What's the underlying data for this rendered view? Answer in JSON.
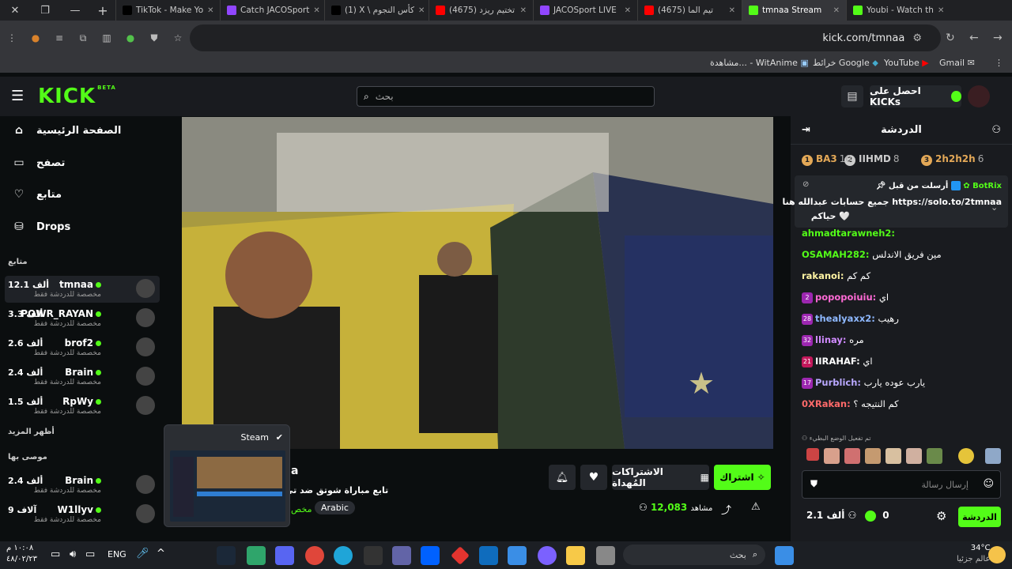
{
  "browser": {
    "tabs": [
      {
        "label": "TikTok - Make Yo",
        "icon": "tiktok-icon",
        "color": "#000000"
      },
      {
        "label": "Catch JACOSport",
        "icon": "twitch-icon",
        "color": "#9146ff"
      },
      {
        "label": "(1) X \\ كأس النجوم",
        "icon": "x-icon",
        "color": "#000000"
      },
      {
        "label": "(4675) تختيم ريزد",
        "icon": "youtube-icon",
        "color": "#ff0000"
      },
      {
        "label": "JACOSport LIVE",
        "icon": "twitch-icon",
        "color": "#9146ff"
      },
      {
        "label": "(4675) تيم الما",
        "icon": "youtube-icon",
        "color": "#ff0000"
      },
      {
        "label": "tmnaa Stream",
        "icon": "kick-icon",
        "color": "#53fc18",
        "active": true
      },
      {
        "label": "Youbi - Watch th",
        "icon": "kick-icon",
        "color": "#53fc18"
      }
    ],
    "url": "kick.com/tmnaa",
    "bookmarks": [
      "Gmail",
      "YouTube",
      "خرائط Google",
      "مشاهدة... - WitAnime"
    ]
  },
  "kick": {
    "logo": "KICK",
    "logo_badge": "BETA",
    "search_placeholder": "بحث",
    "get_kicks": "احصل على KICKs",
    "nav": [
      {
        "label": "الصفحة الرئيسية",
        "icon": "home-icon"
      },
      {
        "label": "تصفح",
        "icon": "browse-icon"
      },
      {
        "label": "متابع",
        "icon": "heart-icon"
      },
      {
        "label": "Drops",
        "icon": "drops-icon"
      }
    ],
    "following_title": "متابع",
    "show_more": "أظهر المزيد",
    "recommended_title": "موصى بها",
    "following": [
      {
        "name": "tmnaa",
        "count": "12.1 ألف",
        "sub": "مخصصة للدردشة فقط",
        "active": true
      },
      {
        "name": "POWR_RAYAN",
        "count": "3.3 ألف",
        "sub": "مخصصة للدردشة فقط"
      },
      {
        "name": "brof2",
        "count": "2.6 ألف",
        "sub": "مخصصة للدردشة فقط"
      },
      {
        "name": "Brain",
        "count": "2.4 ألف",
        "sub": "مخصصة للدردشة فقط"
      },
      {
        "name": "RpWy",
        "count": "1.5 ألف",
        "sub": "مخصصة للدردشة فقط"
      }
    ],
    "recommended": [
      {
        "name": "Brain",
        "count": "2.4 ألف",
        "sub": "مخصصة للدردشة فقط"
      },
      {
        "name": "W1llyv",
        "count": "9 آلاف",
        "sub": "مخصصة للدردشة فقط"
      }
    ],
    "stream": {
      "title_partial": "a",
      "subtitle": "تابع مباراة شوتق ضد تي",
      "tag_language": "Arabic",
      "tag_partial": "مخص",
      "viewers": "12,083",
      "viewers_label": "مشاهد",
      "subscribe": "اشتراك",
      "gift_subs": "الاشتراكات المُهداة"
    },
    "chat": {
      "title": "الدردشة",
      "leaderboard": [
        {
          "name": "2h2h2h",
          "num": "6",
          "rank": "3",
          "color": "#e3a857"
        },
        {
          "name": "IIHMD",
          "num": "8",
          "rank": "2",
          "color": "#cccccc"
        },
        {
          "name": "BA3",
          "num": "10",
          "rank": "1",
          "color": "#e3a857"
        }
      ],
      "pinned_user": "BotRix",
      "pinned_by": "أرسلت من قبل",
      "pinned_text": "جميع حسابات عبدالله هنا https://solo.to/2tmnaa",
      "pinned_text2": "حياكم 🤍",
      "messages": [
        {
          "user": "ahmadtarawneh2:",
          "text": "",
          "color": "#53fc18",
          "badge": ""
        },
        {
          "user": "OSAMAH282:",
          "text": "مين فريق الاندلس",
          "color": "#53fc18",
          "badge": ""
        },
        {
          "user": "rakanoi:",
          "text": "كم كم",
          "color": "#fff4a3",
          "badge": ""
        },
        {
          "user": "popopoiuiu:",
          "text": "اي",
          "color": "#ff6ad5",
          "badge": "2"
        },
        {
          "user": "thealyaxx2:",
          "text": "رهيب",
          "color": "#8eb8ff",
          "badge": "28"
        },
        {
          "user": "llinay:",
          "text": "مره",
          "color": "#d08bff",
          "badge": "32"
        },
        {
          "user": "IIRAHAF:",
          "text": "اي",
          "color": "#ffffff",
          "badge": "21"
        },
        {
          "user": "Purblich:",
          "text": "يارب عوده يارب",
          "color": "#b9a8ff",
          "badge": "17"
        },
        {
          "user": "0XRakan:",
          "text": "كم النتيجه ؟",
          "color": "#ff6a6a",
          "badge": ""
        }
      ],
      "slow_mode": "تم تفعيل الوضع البطيء",
      "input_placeholder": "إرسال رسالة",
      "chat_button": "الدردشة",
      "kicks_count": "0",
      "followers": "2.1 ألف"
    }
  },
  "taskbar": {
    "time": "١٠:٠٨ م",
    "date": "٤٨/٠٢/٢٣",
    "lang": "ENG",
    "weather_temp": "34°C",
    "weather_text": "عالم جزئيا",
    "search_placeholder": "بحث",
    "preview_title": "Steam"
  }
}
